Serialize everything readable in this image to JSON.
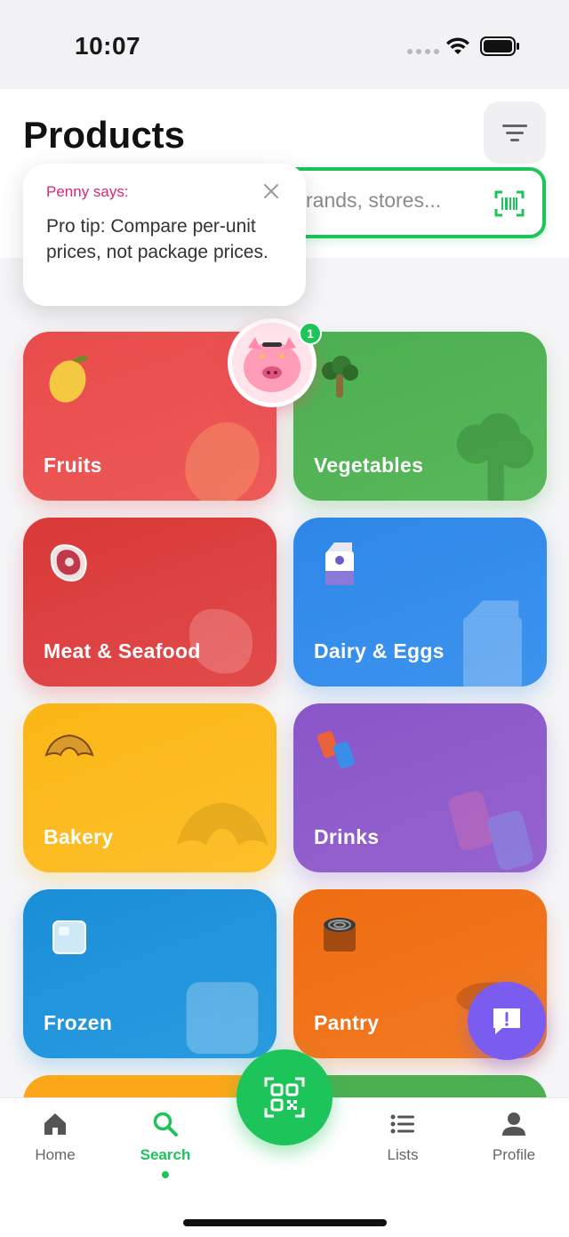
{
  "status_bar": {
    "time": "10:07"
  },
  "header": {
    "title": "Products",
    "search_placeholder": "rands, stores..."
  },
  "tooltip": {
    "title": "Penny says:",
    "text": "Pro tip: Compare per-unit prices, not package prices."
  },
  "mascot": {
    "badge_count": "1"
  },
  "categories": [
    {
      "label": "Fruits",
      "color": "#e94b4b",
      "icon": "mango-icon"
    },
    {
      "label": "Vegetables",
      "color": "#4caf50",
      "icon": "broccoli-icon"
    },
    {
      "label": "Meat & Seafood",
      "color": "#d93838",
      "icon": "steak-icon"
    },
    {
      "label": "Dairy & Eggs",
      "color": "#2e86e8",
      "icon": "milk-carton-icon"
    },
    {
      "label": "Bakery",
      "color": "#fbb616",
      "icon": "croissant-icon"
    },
    {
      "label": "Drinks",
      "color": "#8a56c8",
      "icon": "soda-cans-icon"
    },
    {
      "label": "Frozen",
      "color": "#1a8ed8",
      "icon": "ice-cube-icon"
    },
    {
      "label": "Pantry",
      "color": "#ef6c12",
      "icon": "canned-food-icon"
    }
  ],
  "tab_bar": {
    "home": "Home",
    "search": "Search",
    "lists": "Lists",
    "profile": "Profile",
    "active": "search",
    "accent": "#1dc45a"
  },
  "feedback_color": "#7a5cf0"
}
